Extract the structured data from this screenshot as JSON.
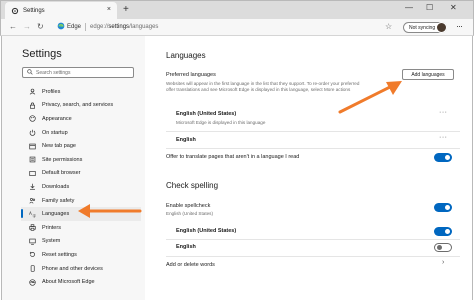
{
  "window": {
    "tab_title": "Settings",
    "close_tab": "×",
    "new_tab": "+",
    "minimize": "—",
    "maximize": "☐",
    "close": "✕"
  },
  "address": {
    "browser_label": "Edge",
    "url_scheme": "edge://",
    "url_host": "settings",
    "url_path": "/languages",
    "sync_label": "Not syncing",
    "more": "···"
  },
  "sidebar": {
    "title": "Settings",
    "search_placeholder": "Search settings",
    "items": [
      {
        "label": "Profiles",
        "icon": "profile-icon"
      },
      {
        "label": "Privacy, search, and services",
        "icon": "lock-icon"
      },
      {
        "label": "Appearance",
        "icon": "appearance-icon"
      },
      {
        "label": "On startup",
        "icon": "power-icon"
      },
      {
        "label": "New tab page",
        "icon": "newtab-icon"
      },
      {
        "label": "Site permissions",
        "icon": "permissions-icon"
      },
      {
        "label": "Default browser",
        "icon": "browser-icon"
      },
      {
        "label": "Downloads",
        "icon": "download-icon"
      },
      {
        "label": "Family safety",
        "icon": "family-icon"
      },
      {
        "label": "Languages",
        "icon": "languages-icon",
        "active": true
      },
      {
        "label": "Printers",
        "icon": "printer-icon"
      },
      {
        "label": "System",
        "icon": "system-icon"
      },
      {
        "label": "Reset settings",
        "icon": "reset-icon"
      },
      {
        "label": "Phone and other devices",
        "icon": "phone-icon"
      },
      {
        "label": "About Microsoft Edge",
        "icon": "edge-icon"
      }
    ]
  },
  "main": {
    "languages_heading": "Languages",
    "preferred_label": "Preferred languages",
    "preferred_desc_1": "Websites will appear in the first language in the list that they support. To re-order your preferred",
    "preferred_desc_2": "offer translations and see Microsoft Edge is displayed in this language, select More actions",
    "add_languages_button": "Add languages",
    "lang1_name": "English (United States)",
    "lang1_sub": "Microsoft Edge is displayed in this language",
    "lang2_name": "English",
    "more_actions": "···",
    "offer_translate_label": "Offer to translate pages that aren't in a language I read",
    "offer_translate_on": true,
    "spell_heading": "Check spelling",
    "enable_spell_label": "Enable spellcheck",
    "enable_spell_sub": "English (United States)",
    "spell_lang1": "English (United States)",
    "spell_lang1_on": true,
    "spell_lang2": "English",
    "spell_lang2_on": false,
    "add_delete_words": "Add or delete words",
    "chevron": "›"
  },
  "colors": {
    "accent": "#0067c0",
    "arrow": "#f07b2b"
  }
}
